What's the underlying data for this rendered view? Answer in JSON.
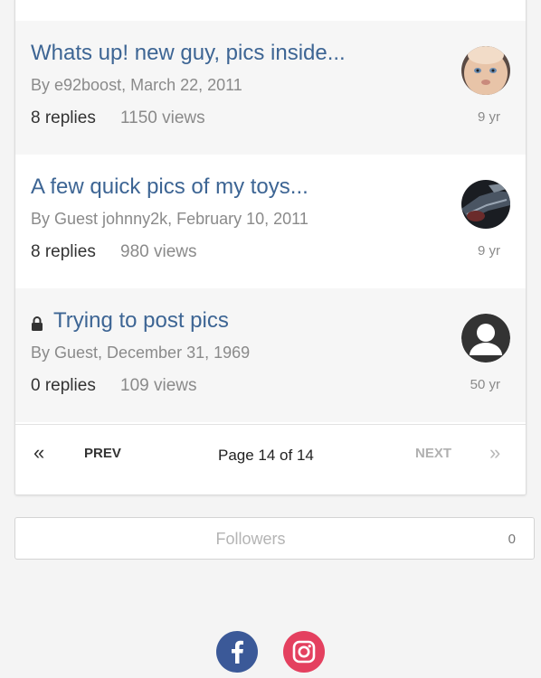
{
  "topics": [
    {
      "title": "Whats up! new guy, pics inside...",
      "meta": "By e92boost, March 22, 2011",
      "replies": "8 replies",
      "views": "1150 views",
      "age": "9 yr",
      "locked": false,
      "avatar_icon": "baby-photo-avatar"
    },
    {
      "title": "A few quick pics of my toys...",
      "meta": "By Guest johnny2k, February 10, 2011",
      "replies": "8 replies",
      "views": "980 views",
      "age": "9 yr",
      "locked": false,
      "avatar_icon": "dark-photo-avatar"
    },
    {
      "title": "Trying to post pics",
      "meta": "By Guest, December 31, 1969",
      "replies": "0 replies",
      "views": "109 views",
      "age": "50 yr",
      "locked": true,
      "avatar_icon": "default-user-avatar"
    }
  ],
  "pagination": {
    "first_icon": "double-chevron-left-icon",
    "first_glyph": "«",
    "prev_label": "PREV",
    "page_info": "Page 14 of 14",
    "next_label": "NEXT",
    "last_icon": "double-chevron-right-icon",
    "last_glyph": "»"
  },
  "followers": {
    "label": "Followers",
    "count": "0"
  },
  "social": {
    "facebook_icon": "facebook-icon",
    "instagram_icon": "instagram-icon"
  },
  "colors": {
    "link": "#3d6594",
    "muted": "#8a8a8a",
    "facebook": "#3b5998",
    "instagram": "#e4405f"
  }
}
